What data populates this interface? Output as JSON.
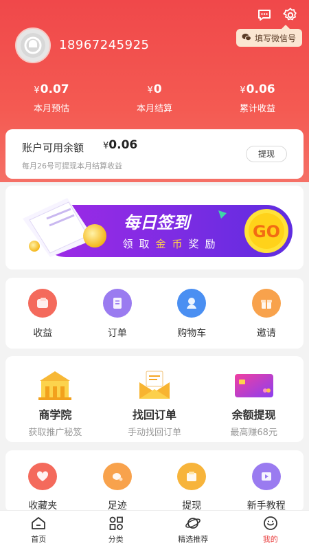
{
  "header": {
    "phone": "18967245925",
    "wechat_pill": "填写微信号"
  },
  "stats": [
    {
      "currency": "¥",
      "value": "0.07",
      "label": "本月预估"
    },
    {
      "currency": "¥",
      "value": "0",
      "label": "本月结算"
    },
    {
      "currency": "¥",
      "value": "0.06",
      "label": "累计收益"
    }
  ],
  "balance": {
    "title": "账户可用余额",
    "currency": "¥",
    "amount": "0.06",
    "subtitle": "每月26号可提现本月结算收益",
    "withdraw_label": "提现"
  },
  "banner": {
    "title": "每日签到",
    "subtitle_chars": [
      "领",
      "取",
      "金",
      "币",
      "奖",
      "励"
    ],
    "go_label": "GO"
  },
  "quick_actions": [
    {
      "label": "收益",
      "icon": "wallet-icon",
      "color": "#f46a5c"
    },
    {
      "label": "订单",
      "icon": "order-icon",
      "color": "#9a7bf0"
    },
    {
      "label": "购物车",
      "icon": "cart-icon",
      "color": "#4a8ff2"
    },
    {
      "label": "邀请",
      "icon": "gift-icon",
      "color": "#f8a24c"
    }
  ],
  "features": [
    {
      "title": "商学院",
      "sub": "获取推广秘笈",
      "icon": "academy-icon"
    },
    {
      "title": "找回订单",
      "sub": "手动找回订单",
      "icon": "envelope-icon"
    },
    {
      "title": "余额提现",
      "sub": "最高赚68元",
      "icon": "card-icon"
    }
  ],
  "tools": [
    {
      "label": "收藏夹",
      "icon": "heart-icon",
      "color": "#f46a5c"
    },
    {
      "label": "足迹",
      "icon": "footprint-icon",
      "color": "#f8a24c"
    },
    {
      "label": "提现",
      "icon": "withdraw-icon",
      "color": "#f7b43b"
    },
    {
      "label": "新手教程",
      "icon": "video-icon",
      "color": "#9a7bf0"
    }
  ],
  "tabbar": [
    {
      "label": "首页",
      "icon": "home-icon",
      "active": false
    },
    {
      "label": "分类",
      "icon": "category-icon",
      "active": false
    },
    {
      "label": "精选推荐",
      "icon": "planet-icon",
      "active": false
    },
    {
      "label": "我的",
      "icon": "profile-icon",
      "active": true
    }
  ],
  "colors": {
    "primary": "#f0484a",
    "active_tab": "#e83a3a"
  }
}
